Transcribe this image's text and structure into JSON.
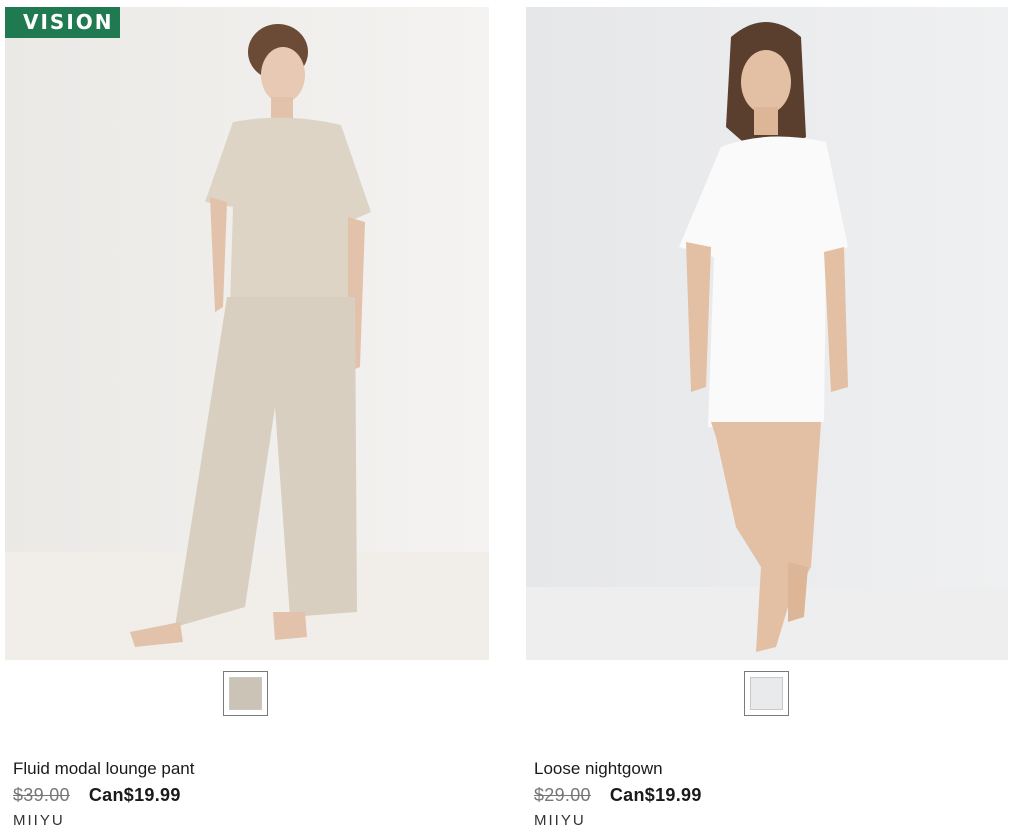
{
  "badge": {
    "text": "VISION"
  },
  "products": [
    {
      "name": "Fluid modal lounge pant",
      "old_price": "$39.00",
      "new_price": "Can$19.99",
      "brand": "MIIYU",
      "swatch_color": "#cbc3b6",
      "image": "model-in-beige-lounge-set"
    },
    {
      "name": "Loose nightgown",
      "old_price": "$29.00",
      "new_price": "Can$19.99",
      "brand": "MIIYU",
      "swatch_color": "#e9eaec",
      "image": "model-in-white-nightgown"
    }
  ]
}
